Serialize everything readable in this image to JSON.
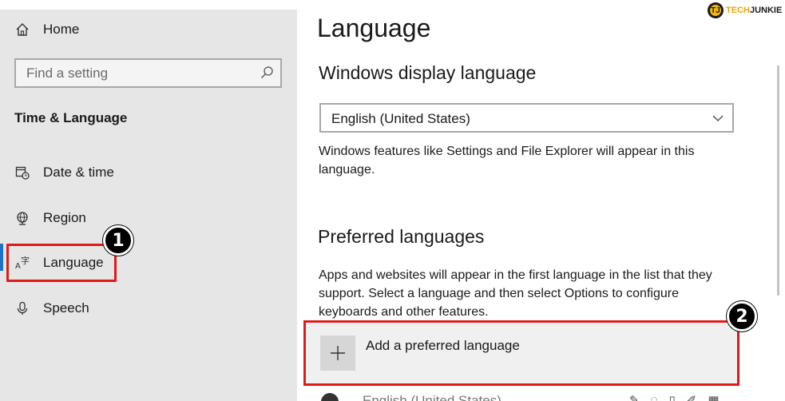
{
  "logo": {
    "mark": "TJ",
    "word_part1": "TECH",
    "word_part2": "JUNKIE"
  },
  "sidebar": {
    "home_label": "Home",
    "search_placeholder": "Find a setting",
    "section_title": "Time & Language",
    "items": [
      {
        "label": "Date & time",
        "icon": "calendar-clock-icon"
      },
      {
        "label": "Region",
        "icon": "globe-icon"
      },
      {
        "label": "Language",
        "icon": "language-icon"
      },
      {
        "label": "Speech",
        "icon": "microphone-icon"
      }
    ]
  },
  "main": {
    "page_title": "Language",
    "display_heading": "Windows display language",
    "display_select_value": "English (United States)",
    "display_desc": "Windows features like Settings and File Explorer will appear in this language.",
    "preferred_heading": "Preferred languages",
    "preferred_desc": "Apps and websites will appear in the first language in the list that they support. Select a language and then select Options to configure keyboards and other features.",
    "add_language_label": "Add a preferred language",
    "partial_row_label": "English (United States)"
  },
  "annotations": {
    "badge1": "1",
    "badge2": "2"
  },
  "colors": {
    "accent": "#1a73c8",
    "highlight": "#e01919",
    "sidebar_bg": "#e6e6e6"
  }
}
